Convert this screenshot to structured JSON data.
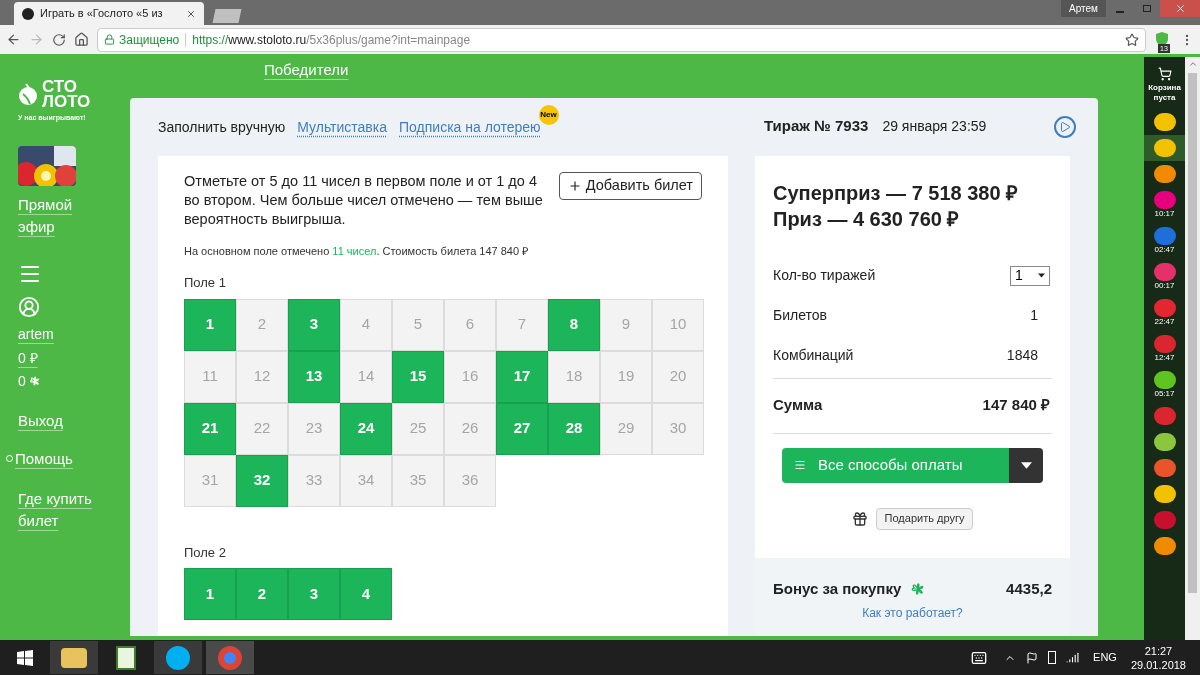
{
  "browser": {
    "tab_title": "Играть в «Гослото «5 из",
    "user": "Артем",
    "security": "Защищено",
    "url": {
      "scheme": "https://",
      "host": "www.stoloto.ru",
      "path": "/5x36plus/game?int=mainpage"
    },
    "extension_badge": "13"
  },
  "site": {
    "logo": [
      "СТО",
      "ЛОТО"
    ],
    "tagline": "У нас выигрывают!",
    "top_link": "Победители",
    "sidebar": [
      {
        "kind": "live",
        "label": "Прямой эфир"
      },
      {
        "kind": "menu"
      },
      {
        "kind": "user",
        "label": "artem"
      },
      {
        "kind": "link",
        "label": "0 ₽"
      },
      {
        "kind": "bonus",
        "label": "0"
      },
      {
        "kind": "link",
        "label": "Выход"
      },
      {
        "kind": "help",
        "label": "Помощь"
      },
      {
        "kind": "link",
        "label": "Где купить билет"
      }
    ]
  },
  "game": {
    "tabs": [
      {
        "label": "Заполнить вручную",
        "selected": true
      },
      {
        "label": "Мультиставка",
        "selected": false
      },
      {
        "label": "Подписка на лотерею",
        "selected": false,
        "badge": "New"
      }
    ],
    "draw": "Тираж № 7933",
    "date": "29 января 23:59",
    "instruction": "Отметьте от 5 до 11 чисел в первом поле и от 1 до 4 во втором. Чем больше чисел отмечено — тем выше вероятность выигрыша.",
    "add_ticket": "Добавить билет",
    "summary": {
      "before": "На основном поле отмечено ",
      "count": "11 чисел",
      "after": ". Стоимость билета 147 840 ₽"
    },
    "fields": [
      {
        "label": "Поле 1",
        "numbers": [
          {
            "value": "1",
            "selected": true
          },
          {
            "value": "2",
            "selected": false
          },
          {
            "value": "3",
            "selected": true
          },
          {
            "value": "4",
            "selected": false
          },
          {
            "value": "5",
            "selected": false
          },
          {
            "value": "6",
            "selected": false
          },
          {
            "value": "7",
            "selected": false
          },
          {
            "value": "8",
            "selected": true
          },
          {
            "value": "9",
            "selected": false
          },
          {
            "value": "10",
            "selected": false
          },
          {
            "value": "11",
            "selected": false
          },
          {
            "value": "12",
            "selected": false
          },
          {
            "value": "13",
            "selected": true
          },
          {
            "value": "14",
            "selected": false
          },
          {
            "value": "15",
            "selected": true
          },
          {
            "value": "16",
            "selected": false
          },
          {
            "value": "17",
            "selected": true
          },
          {
            "value": "18",
            "selected": false
          },
          {
            "value": "19",
            "selected": false
          },
          {
            "value": "20",
            "selected": false
          },
          {
            "value": "21",
            "selected": true
          },
          {
            "value": "22",
            "selected": false
          },
          {
            "value": "23",
            "selected": false
          },
          {
            "value": "24",
            "selected": true
          },
          {
            "value": "25",
            "selected": false
          },
          {
            "value": "26",
            "selected": false
          },
          {
            "value": "27",
            "selected": true
          },
          {
            "value": "28",
            "selected": true
          },
          {
            "value": "29",
            "selected": false
          },
          {
            "value": "30",
            "selected": false
          },
          {
            "value": "31",
            "selected": false
          },
          {
            "value": "32",
            "selected": true
          },
          {
            "value": "33",
            "selected": false
          },
          {
            "value": "34",
            "selected": false
          },
          {
            "value": "35",
            "selected": false
          },
          {
            "value": "36",
            "selected": false
          }
        ]
      },
      {
        "label": "Поле 2",
        "numbers": [
          {
            "value": "1",
            "selected": true
          },
          {
            "value": "2",
            "selected": true
          },
          {
            "value": "3",
            "selected": true
          },
          {
            "value": "4",
            "selected": true
          }
        ]
      }
    ],
    "summary_panel": {
      "superprize": "Суперприз — 7 518 380 ₽",
      "prize": "Приз — 4 630 760 ₽",
      "rows": [
        {
          "kind": "select",
          "label": "Кол-во тиражей",
          "value": "1"
        },
        {
          "kind": "text",
          "label": "Билетов",
          "value": "1"
        },
        {
          "kind": "text",
          "label": "Комбинаций",
          "value": "1848"
        }
      ],
      "total": {
        "label": "Сумма",
        "value": "147 840 ₽"
      },
      "pay_button": "Все способы оплаты",
      "gift_button": "Подарить другу",
      "bonus": {
        "label": "Бонус за покупку",
        "value": "4435,2",
        "link": "Как это работает?"
      }
    }
  },
  "games_bar": {
    "cart": "Корзина пуста",
    "games": [
      {
        "color": "#f2c200",
        "selected": false
      },
      {
        "color": "#f2c200",
        "selected": true
      },
      {
        "color": "#f08a00",
        "selected": false
      },
      {
        "color": "#e6007e",
        "selected": false,
        "time": "10:17"
      },
      {
        "color": "#1e6fd9",
        "selected": false,
        "time": "02:47"
      },
      {
        "color": "#e5306b",
        "selected": false,
        "time": "00:17"
      },
      {
        "color": "#e3262f",
        "selected": false,
        "time": "22:47"
      },
      {
        "color": "#d9262f",
        "selected": false,
        "time": "12:47"
      },
      {
        "color": "#5fc421",
        "selected": false,
        "time": "05:17"
      },
      {
        "color": "#d9262f",
        "selected": false
      },
      {
        "color": "#8cc63f",
        "selected": false
      },
      {
        "color": "#e8552b",
        "selected": false
      },
      {
        "color": "#f2c200",
        "selected": false
      },
      {
        "color": "#c8102e",
        "selected": false
      },
      {
        "color": "#f08a00",
        "selected": false
      }
    ]
  },
  "taskbar": {
    "language": "ENG",
    "time": "21:27",
    "date": "29.01.2018"
  }
}
